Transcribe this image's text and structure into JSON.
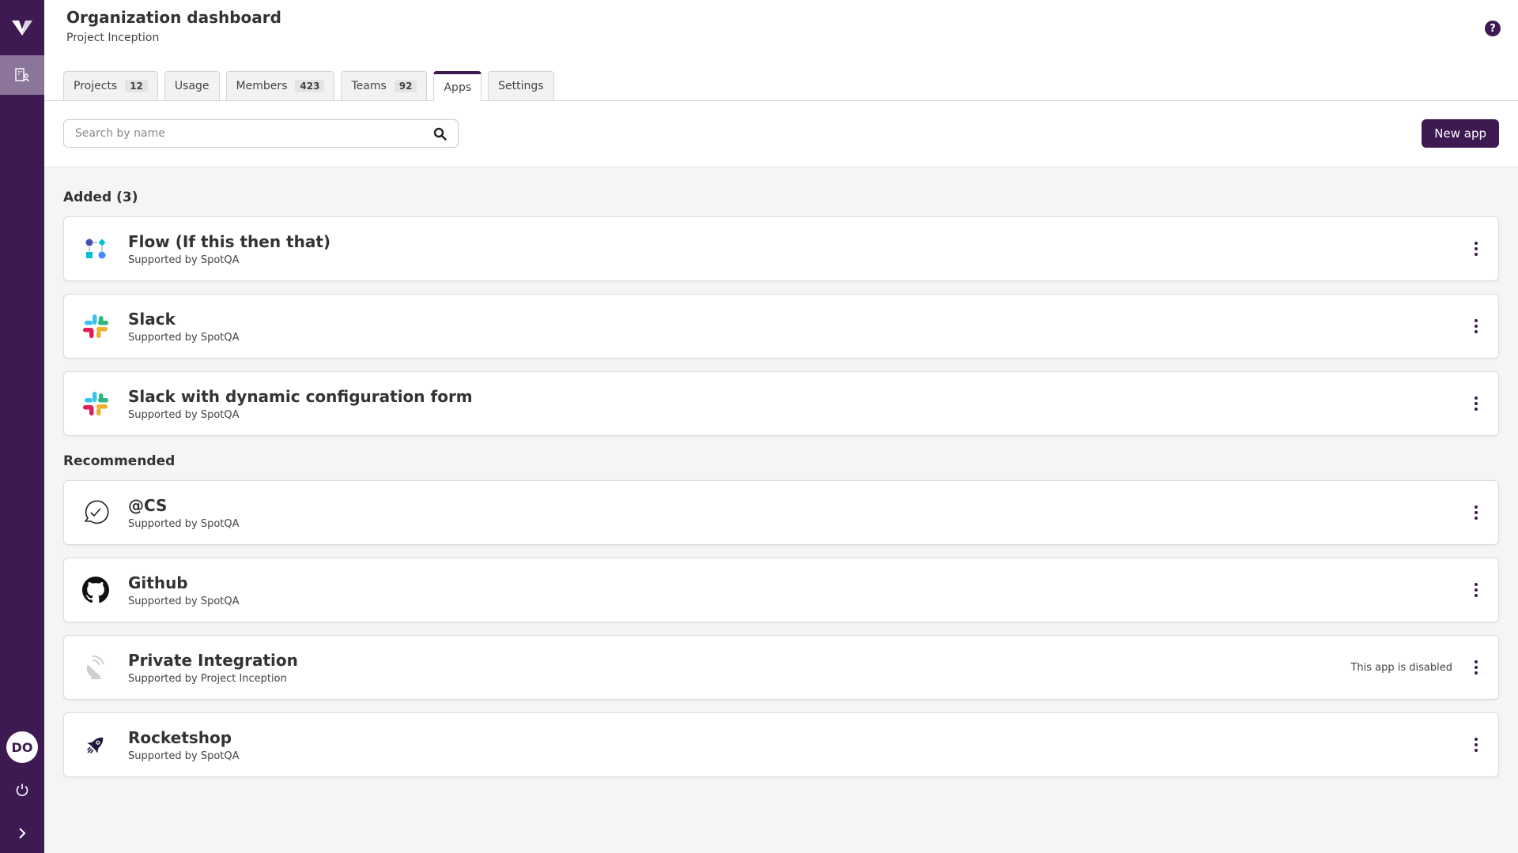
{
  "sidebar": {
    "logo": "V-logo",
    "nav_items": [
      {
        "icon": "organization-icon",
        "active": true
      }
    ],
    "avatar_initials": "DO",
    "power_icon": "power-icon",
    "expand_icon": "chevron-right-icon"
  },
  "header": {
    "title": "Organization dashboard",
    "subtitle": "Project Inception",
    "help_label": "?"
  },
  "tabs": [
    {
      "label": "Projects",
      "count": "12",
      "active": false
    },
    {
      "label": "Usage",
      "count": null,
      "active": false
    },
    {
      "label": "Members",
      "count": "423",
      "active": false
    },
    {
      "label": "Teams",
      "count": "92",
      "active": false
    },
    {
      "label": "Apps",
      "count": null,
      "active": true
    },
    {
      "label": "Settings",
      "count": null,
      "active": false
    }
  ],
  "toolbar": {
    "search_placeholder": "Search by name",
    "search_value": "",
    "new_app_label": "New app"
  },
  "sections": {
    "added": {
      "title": "Added (3)",
      "apps": [
        {
          "name": "Flow (If this then that)",
          "supported_by": "Supported by SpotQA",
          "icon": "flow-icon",
          "status": ""
        },
        {
          "name": "Slack",
          "supported_by": "Supported by SpotQA",
          "icon": "slack-icon",
          "status": ""
        },
        {
          "name": "Slack with dynamic configuration form",
          "supported_by": "Supported by SpotQA",
          "icon": "slack-icon",
          "status": ""
        }
      ]
    },
    "recommended": {
      "title": "Recommended",
      "apps": [
        {
          "name": "@CS",
          "supported_by": "Supported by SpotQA",
          "icon": "chat-check-icon",
          "status": ""
        },
        {
          "name": "Github",
          "supported_by": "Supported by SpotQA",
          "icon": "github-icon",
          "status": ""
        },
        {
          "name": "Private Integration",
          "supported_by": "Supported by Project Inception",
          "icon": "satellite-dish-icon",
          "status": "This app is disabled"
        },
        {
          "name": "Rocketshop",
          "supported_by": "Supported by SpotQA",
          "icon": "rocket-icon",
          "status": ""
        }
      ]
    }
  },
  "colors": {
    "brand": "#3d1a52",
    "sidebar_active": "#8b7599",
    "background": "#f5f5f5"
  }
}
